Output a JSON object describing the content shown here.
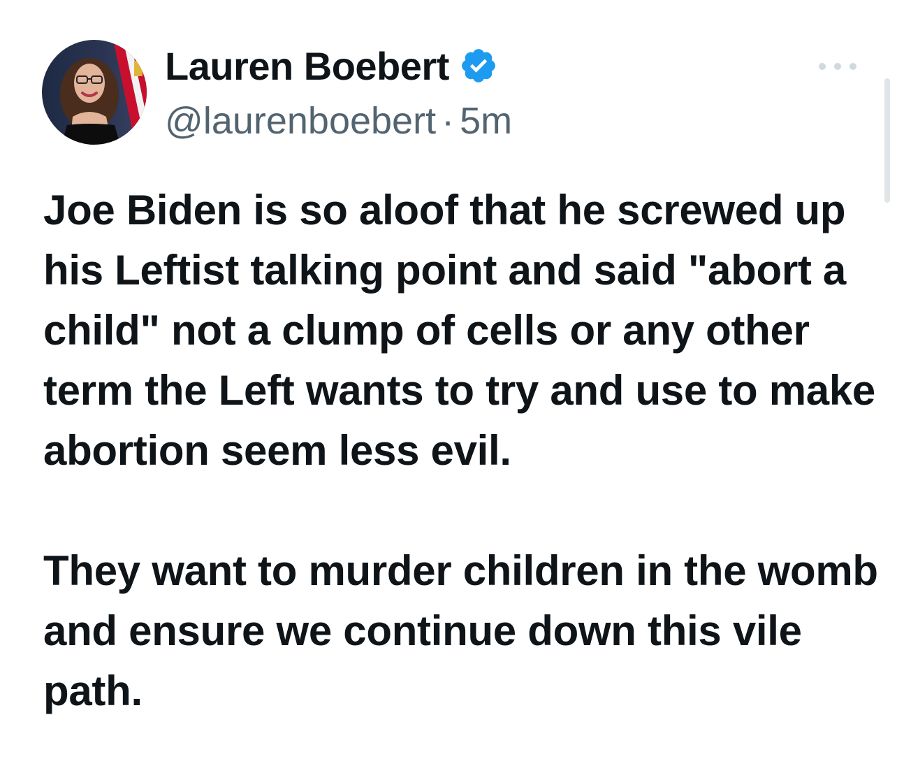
{
  "author": {
    "display_name": "Lauren Boebert",
    "handle": "@laurenboebert",
    "separator": "·",
    "timestamp": "5m",
    "verified": true,
    "verified_color": "#1d9bf0"
  },
  "icons": {
    "verified": "verified-badge-icon",
    "more": "more-options-icon"
  },
  "tweet": {
    "paragraphs": [
      "Joe Biden is so aloof that he screwed up his Leftist talking point and said \"abort a child\" not a clump of cells or any other term the Left wants to try and use to make abortion seem less evil.",
      "They want to murder children in the womb and ensure we continue down this vile path."
    ]
  },
  "colors": {
    "text": "#0f1419",
    "secondary_text": "#536471",
    "background": "#ffffff"
  }
}
